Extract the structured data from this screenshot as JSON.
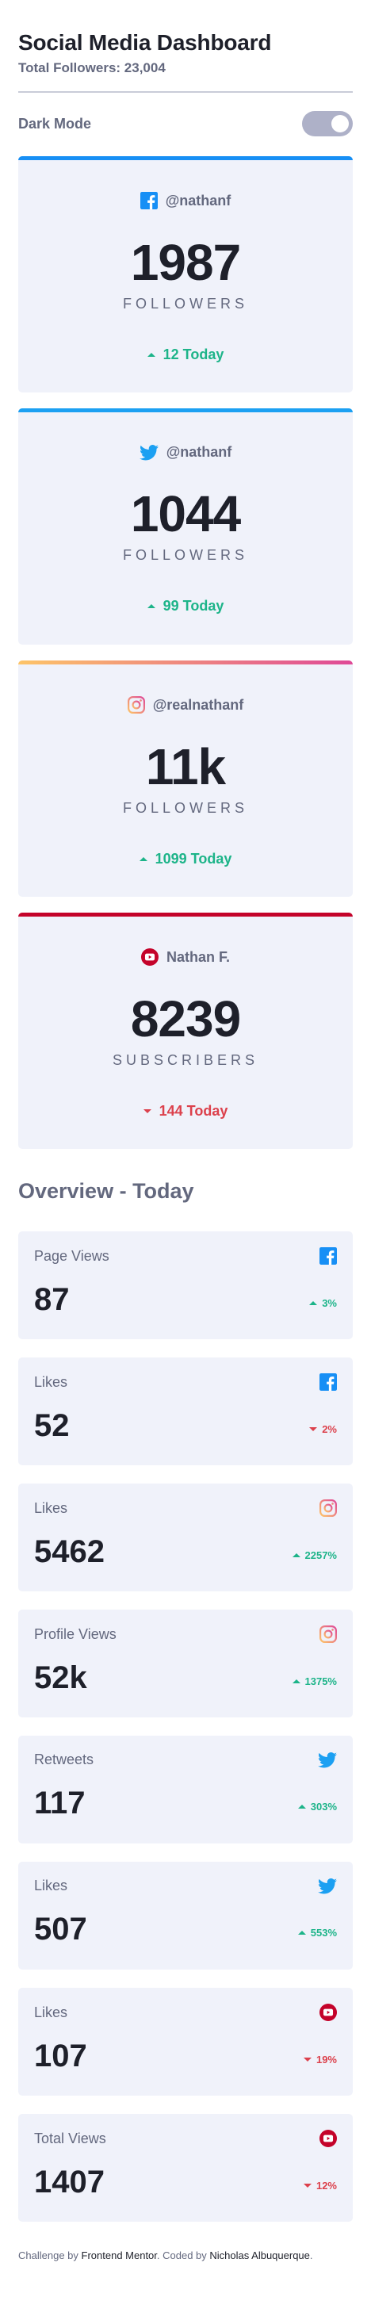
{
  "header": {
    "title": "Social Media Dashboard",
    "subtitle": "Total Followers: 23,004"
  },
  "theme": {
    "label": "Dark Mode",
    "dark_mode_on": false
  },
  "colors": {
    "facebook": "#178ff5",
    "twitter": "#1ca0f2",
    "instagram_start": "#fdc468",
    "instagram_end": "#df4996",
    "youtube": "#c4032a",
    "up": "#1db489",
    "down": "#dc414c"
  },
  "follower_cards": [
    {
      "network": "facebook",
      "icon": "facebook-icon",
      "handle": "@nathanf",
      "count": "1987",
      "unit": "FOLLOWERS",
      "change": "12 Today",
      "direction": "up"
    },
    {
      "network": "twitter",
      "icon": "twitter-icon",
      "handle": "@nathanf",
      "count": "1044",
      "unit": "FOLLOWERS",
      "change": "99 Today",
      "direction": "up"
    },
    {
      "network": "instagram",
      "icon": "instagram-icon",
      "handle": "@realnathanf",
      "count": "11k",
      "unit": "FOLLOWERS",
      "change": "1099 Today",
      "direction": "up"
    },
    {
      "network": "youtube",
      "icon": "youtube-icon",
      "handle": "Nathan F.",
      "count": "8239",
      "unit": "SUBSCRIBERS",
      "change": "144 Today",
      "direction": "down"
    }
  ],
  "overview": {
    "title": "Overview - Today",
    "items": [
      {
        "label": "Page Views",
        "network": "facebook",
        "icon": "facebook-icon",
        "value": "87",
        "change": "3%",
        "direction": "up"
      },
      {
        "label": "Likes",
        "network": "facebook",
        "icon": "facebook-icon",
        "value": "52",
        "change": "2%",
        "direction": "down"
      },
      {
        "label": "Likes",
        "network": "instagram",
        "icon": "instagram-icon",
        "value": "5462",
        "change": "2257%",
        "direction": "up"
      },
      {
        "label": "Profile Views",
        "network": "instagram",
        "icon": "instagram-icon",
        "value": "52k",
        "change": "1375%",
        "direction": "up"
      },
      {
        "label": "Retweets",
        "network": "twitter",
        "icon": "twitter-icon",
        "value": "117",
        "change": "303%",
        "direction": "up"
      },
      {
        "label": "Likes",
        "network": "twitter",
        "icon": "twitter-icon",
        "value": "507",
        "change": "553%",
        "direction": "up"
      },
      {
        "label": "Likes",
        "network": "youtube",
        "icon": "youtube-icon",
        "value": "107",
        "change": "19%",
        "direction": "down"
      },
      {
        "label": "Total Views",
        "network": "youtube",
        "icon": "youtube-icon",
        "value": "1407",
        "change": "12%",
        "direction": "down"
      }
    ]
  },
  "footer": {
    "prefix": "Challenge by",
    "challenge_link": "Frontend Mentor",
    "middle": ". Coded by",
    "author_link": "Nicholas Albuquerque",
    "suffix": "."
  }
}
